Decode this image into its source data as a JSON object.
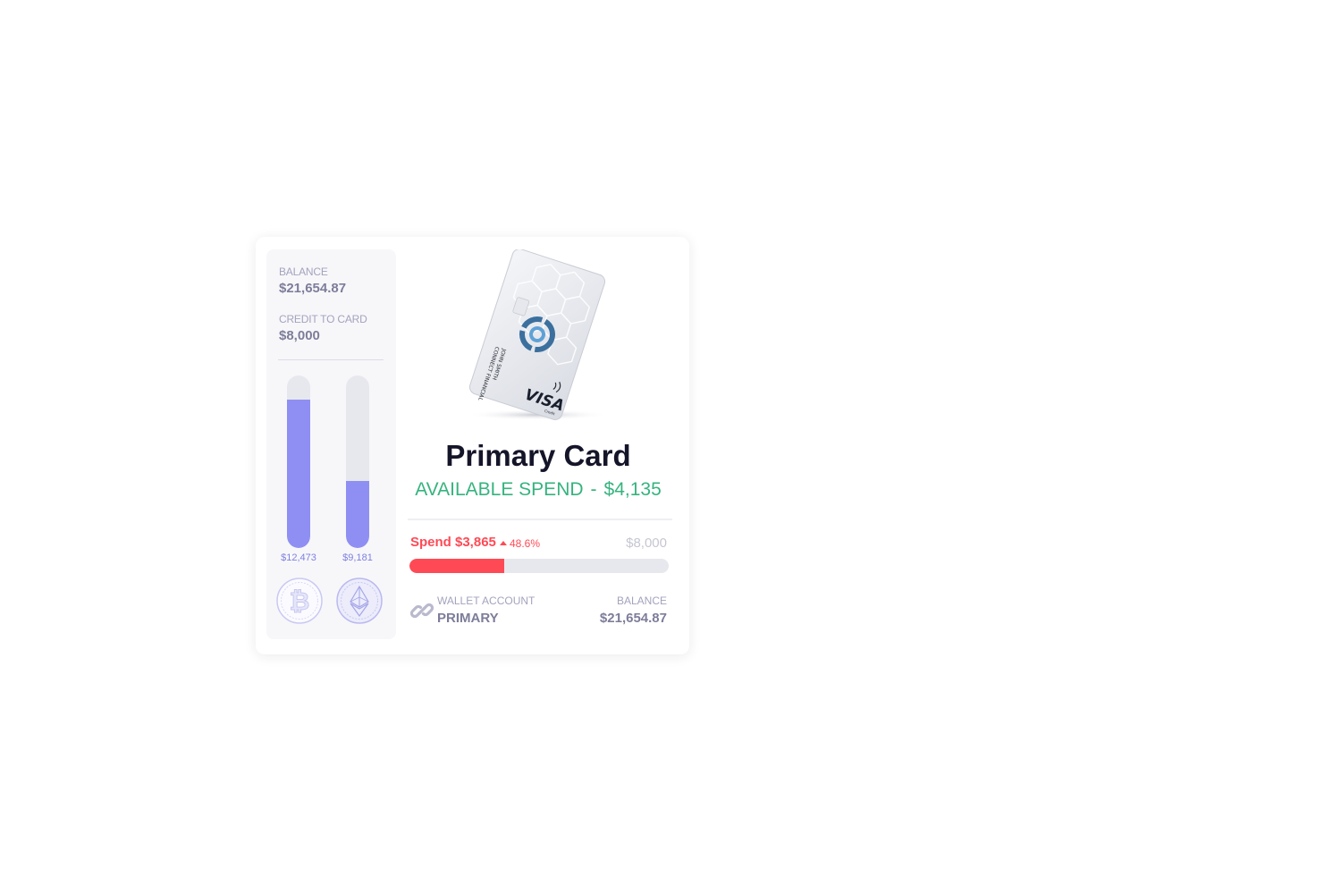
{
  "left_panel": {
    "balance_label": "BALANCE",
    "balance_value": "$21,654.87",
    "credit_label": "CREDIT TO CARD",
    "credit_value": "$8,000",
    "bars": [
      {
        "coin": "bitcoin",
        "icon": "bitcoin-icon",
        "value_label": "$12,473",
        "level": 0.86
      },
      {
        "coin": "ethereum",
        "icon": "ethereum-icon",
        "value_label": "$9,181",
        "level": 0.39
      }
    ]
  },
  "card": {
    "title": "Primary Card",
    "available_label": "AVAILABLE SPEND",
    "separator": "-",
    "available_value": "$4,135",
    "image": {
      "holder_name": "JOHN SMITH",
      "issuer": "CONNECT FINANCIAL",
      "network": "VISA",
      "network_sub": "Credit",
      "logo_icon": "connect-logo-icon",
      "contactless_icon": "contactless-icon"
    }
  },
  "spend": {
    "label": "Spend $3,865",
    "change": "48.6%",
    "limit": "$8,000",
    "fill_fraction": 0.365
  },
  "wallet": {
    "icon": "link-icon",
    "label": "WALLET ACCOUNT",
    "value": "PRIMARY",
    "balance_label": "BALANCE",
    "balance_value": "$21,654.87"
  },
  "colors": {
    "accent_purple": "#8f8ff3",
    "available_green": "#36b37e",
    "spend_red": "#ff4a55",
    "muted_text": "#a3a3bd"
  }
}
